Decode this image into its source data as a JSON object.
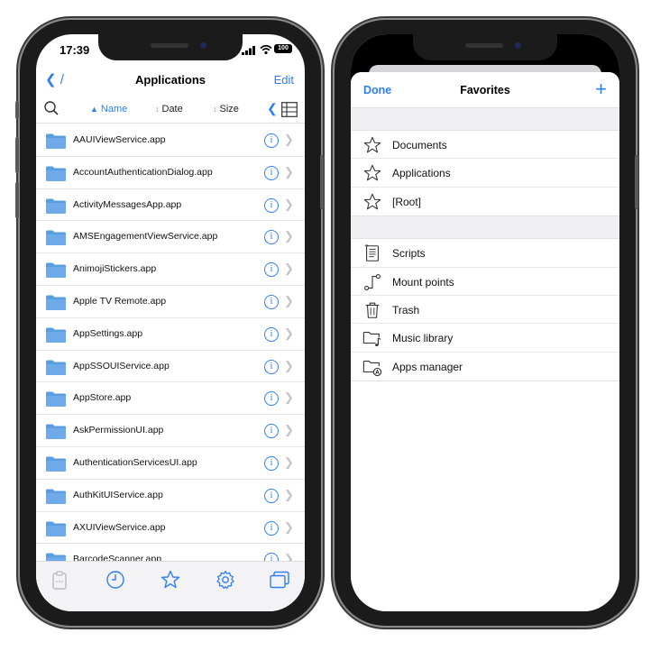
{
  "left_phone": {
    "status": {
      "time": "17:39",
      "battery": "100"
    },
    "nav": {
      "back_label": "/",
      "title": "Applications",
      "edit_label": "Edit"
    },
    "sort": {
      "name": "Name",
      "date": "Date",
      "size": "Size",
      "active": "name"
    },
    "files": [
      "AAUIViewService.app",
      "AccountAuthenticationDialog.app",
      "ActivityMessagesApp.app",
      "AMSEngagementViewService.app",
      "AnimojiStickers.app",
      "Apple TV Remote.app",
      "AppSettings.app",
      "AppSSOUIService.app",
      "AppStore.app",
      "AskPermissionUI.app",
      "AuthenticationServicesUI.app",
      "AuthKitUIService.app",
      "AXUIViewService.app",
      "BarcodeScanner.app"
    ],
    "tabs": [
      "clipboard-icon",
      "clock-icon",
      "star-icon",
      "gear-icon",
      "windows-icon"
    ],
    "active_tab": "star-icon"
  },
  "right_phone": {
    "header": {
      "done_label": "Done",
      "title": "Favorites",
      "add_label": "+"
    },
    "favorites": [
      {
        "label": "Documents",
        "icon": "star-icon"
      },
      {
        "label": "Applications",
        "icon": "star-icon"
      },
      {
        "label": "[Root]",
        "icon": "star-icon"
      }
    ],
    "tools": [
      {
        "label": "Scripts",
        "icon": "script-icon"
      },
      {
        "label": "Mount points",
        "icon": "mount-icon"
      },
      {
        "label": "Trash",
        "icon": "trash-icon"
      },
      {
        "label": "Music library",
        "icon": "music-folder-icon"
      },
      {
        "label": "Apps manager",
        "icon": "apps-folder-icon"
      }
    ]
  },
  "colors": {
    "accent": "#2f7ef6",
    "folder": "#5b9ee0",
    "separator": "#e6e6e9",
    "phone_frame": "#1b1b1b"
  }
}
